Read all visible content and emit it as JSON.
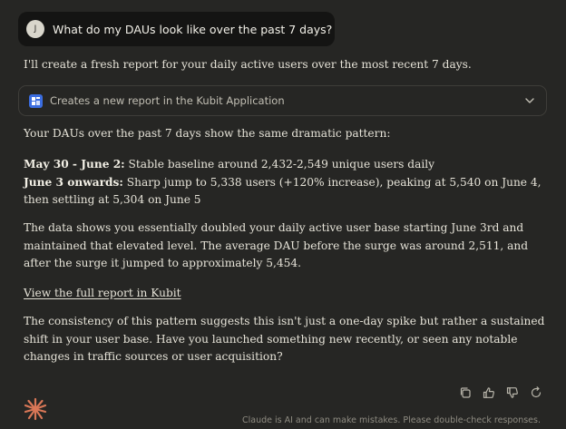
{
  "user_message": {
    "avatar_initial": "J",
    "text": "What do my DAUs look like over the past 7 days?"
  },
  "response": {
    "intro": "I'll create a fresh report for your daily active users over the most recent 7 days.",
    "tool_call": {
      "icon": "kubit-app-icon",
      "label": "Creates a new report in the Kubit Application",
      "expand_icon": "chevron-down-icon"
    },
    "summary": "Your DAUs over the past 7 days show the same dramatic pattern:",
    "points": {
      "baseline_label": "May 30 - June 2:",
      "baseline_text": " Stable baseline around 2,432-2,549 unique users daily",
      "jump_label": "June 3 onwards:",
      "jump_text_line1": " Sharp jump to 5,338 users (+120% increase), peaking at 5,540 on June 4,",
      "jump_text_line2": "then settling at 5,304 on June 5"
    },
    "analysis_lines": [
      "The data shows you essentially doubled your daily active user base starting June 3rd and",
      "maintained that elevated level. The average DAU before the surge was around 2,511, and",
      "after the surge it jumped to approximately 5,454."
    ],
    "report_link": "View the full report in Kubit",
    "closing_lines": [
      "The consistency of this pattern suggests this isn't just a one-day spike but rather a sustained",
      "shift in your user base. Have you launched something new recently, or seen any notable",
      "changes in traffic sources or user acquisition?"
    ]
  },
  "actions": {
    "copy_icon": "copy-icon",
    "thumbs_up_icon": "thumbs-up-icon",
    "thumbs_down_icon": "thumbs-down-icon",
    "retry_icon": "retry-icon"
  },
  "footer": {
    "disclaimer": "Claude is AI and can make mistakes. Please double-check responses."
  },
  "colors": {
    "background": "#262624",
    "user_bubble": "#141413",
    "brand_accent": "#d97757",
    "tool_icon": "#3b6de0"
  }
}
